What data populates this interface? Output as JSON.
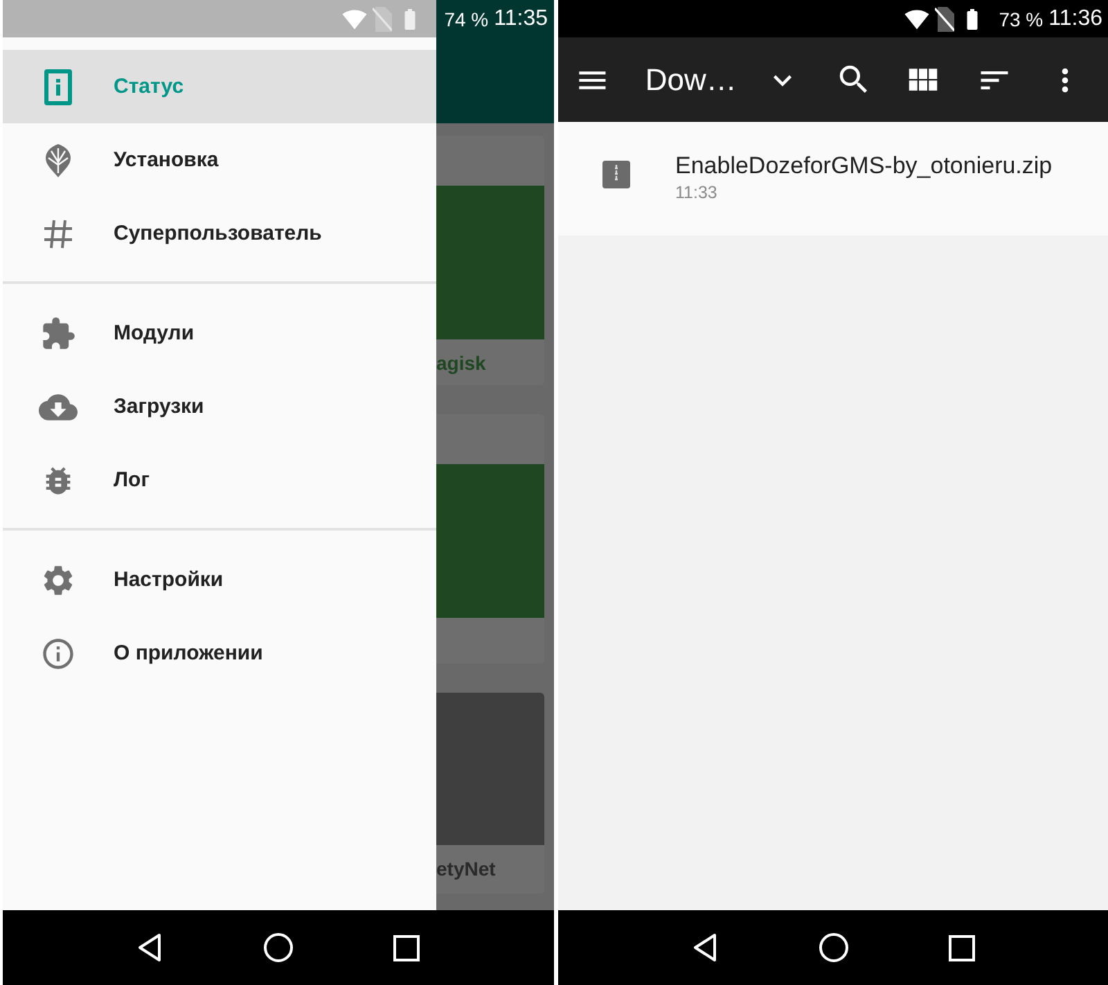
{
  "phones": [
    {
      "status_bar": {
        "battery": "74 %",
        "time": "11:35"
      },
      "drawer": {
        "groups": [
          [
            {
              "label": "Статус",
              "selected": true
            },
            {
              "label": "Установка",
              "selected": false
            },
            {
              "label": "Суперпользователь",
              "selected": false
            }
          ],
          [
            {
              "label": "Модули",
              "selected": false
            },
            {
              "label": "Загрузки",
              "selected": false
            },
            {
              "label": "Лог",
              "selected": false
            }
          ],
          [
            {
              "label": "Настройки",
              "selected": false
            },
            {
              "label": "О приложении",
              "selected": false
            }
          ]
        ]
      },
      "background_cards": [
        {
          "kind": "green",
          "label": "agisk"
        },
        {
          "kind": "green"
        },
        {
          "kind": "dark",
          "label": "etyNet"
        }
      ]
    },
    {
      "status_bar": {
        "battery": "73 %",
        "time": "11:36"
      },
      "toolbar": {
        "title": "Dow…"
      },
      "files": [
        {
          "name": "EnableDozeforGMS-by_otonieru.zip",
          "time": "11:33"
        }
      ]
    }
  ]
}
